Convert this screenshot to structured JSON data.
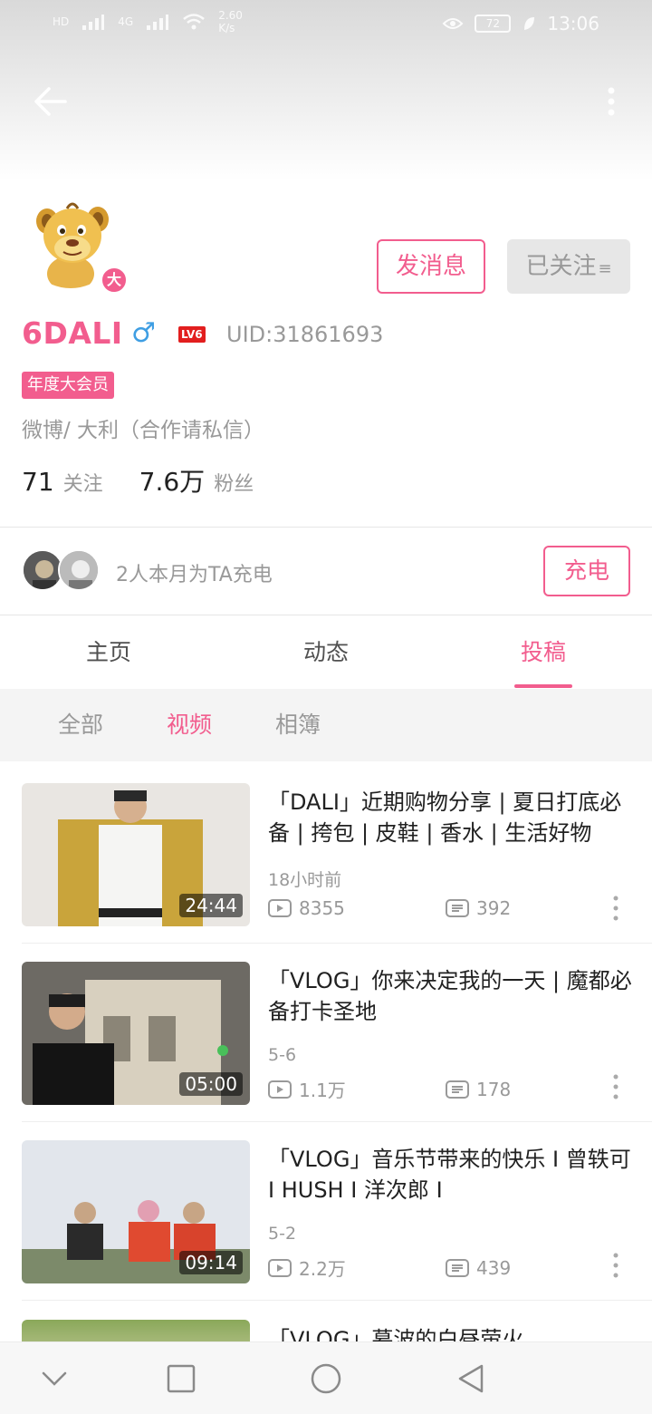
{
  "status_bar": {
    "network_speed": "2.60\nK/s",
    "network_label": "4G",
    "hd_label": "HD",
    "time": "13:06",
    "battery": "72"
  },
  "profile": {
    "name": "6DALI",
    "gender_symbol": "♂",
    "level": "LV6",
    "uid": "UID:31861693",
    "vip_badge": "年度大会员",
    "avatar_badge": "大",
    "signature": "微博/  大利（合作请私信）",
    "following_count": "71",
    "following_label": "关注",
    "followers_count": "7.6万",
    "followers_label": "粉丝"
  },
  "actions": {
    "message_label": "发消息",
    "followed_label": "已关注"
  },
  "charge": {
    "text": "2人本月为TA充电",
    "button_label": "充电"
  },
  "tabs": [
    {
      "label": "主页",
      "active": false
    },
    {
      "label": "动态",
      "active": false
    },
    {
      "label": "投稿",
      "active": true
    }
  ],
  "subtabs": [
    {
      "label": "全部",
      "active": false
    },
    {
      "label": "视频",
      "active": true
    },
    {
      "label": "相簿",
      "active": false
    }
  ],
  "videos": [
    {
      "title": "「DALI」近期购物分享 | 夏日打底必备 | 挎包 | 皮鞋 | 香水 | 生活好物",
      "time": "18小时前",
      "views": "8355",
      "comments": "392",
      "duration": "24:44"
    },
    {
      "title": "「VLOG」你来决定我的一天 | 魔都必备打卡圣地",
      "time": "5-6",
      "views": "1.1万",
      "comments": "178",
      "duration": "05:00"
    },
    {
      "title": "「VLOG」音乐节带来的快乐 I 曾轶可 I HUSH I 洋次郎 I",
      "time": "5-2",
      "views": "2.2万",
      "comments": "439",
      "duration": "09:14"
    }
  ],
  "partial_video": {
    "title": "「VLOG」慕波的白昼萤火"
  },
  "colors": {
    "accent": "#f25d8e",
    "gender": "#3f9ee3",
    "level": "#e21e1e",
    "muted": "#999999"
  }
}
